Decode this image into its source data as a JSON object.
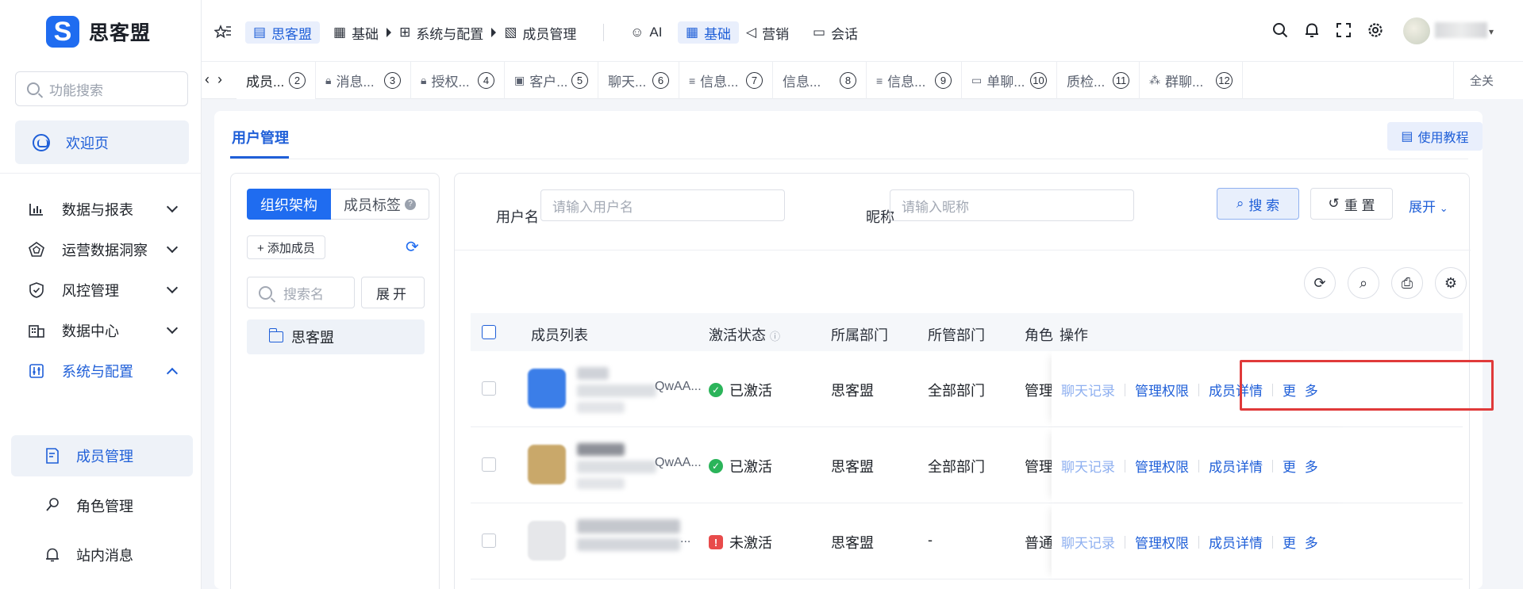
{
  "app": {
    "logo_letter": "S",
    "name": "思客盟"
  },
  "sidebar": {
    "search_placeholder": "功能搜索",
    "welcome": "欢迎页",
    "items": [
      {
        "label": "数据与报表",
        "icon": "bar-chart-icon"
      },
      {
        "label": "运营数据洞察",
        "icon": "radar-icon"
      },
      {
        "label": "风控管理",
        "icon": "shield-check-icon"
      },
      {
        "label": "数据中心",
        "icon": "building-icon"
      },
      {
        "label": "系统与配置",
        "icon": "sliders-icon"
      }
    ],
    "sub_items": [
      {
        "label": "成员管理",
        "icon": "member-doc-icon"
      },
      {
        "label": "角色管理",
        "icon": "key-icon"
      },
      {
        "label": "站内消息",
        "icon": "bell-icon"
      }
    ]
  },
  "topbar": {
    "org_pill": "思客盟",
    "breadcrumb": [
      "基础",
      "系统与配置",
      "成员管理"
    ],
    "modules": [
      "AI",
      "基础",
      "营销",
      "会话"
    ]
  },
  "tabs": {
    "items": [
      {
        "label": "成员...",
        "num": "②"
      },
      {
        "label": "消息...",
        "num": "③"
      },
      {
        "label": "授权...",
        "num": "④"
      },
      {
        "label": "客户...",
        "num": "⑤"
      },
      {
        "label": "聊天...",
        "num": "⑥"
      },
      {
        "label": "信息...",
        "num": "⑦"
      },
      {
        "label": "信息...",
        "num": "⑧"
      },
      {
        "label": "信息...",
        "num": "⑨"
      },
      {
        "label": "单聊...",
        "num": "⑩"
      },
      {
        "label": "质检...",
        "num": "⑪"
      },
      {
        "label": "群聊...",
        "num": "⑫"
      }
    ],
    "close_all": "全关"
  },
  "page": {
    "tab": "用户管理",
    "tutorial": "使用教程"
  },
  "org": {
    "seg_on": "组织架构",
    "seg_off": "成员标签",
    "add_member": "+ 添加成员",
    "search_placeholder": "搜索名",
    "expand": "展开",
    "root_node": "思客盟"
  },
  "filters": {
    "username_label": "用户名",
    "username_placeholder": "请输入用户名",
    "nickname_label": "昵称",
    "nickname_placeholder": "请输入昵称",
    "search": "搜 索",
    "reset": "重 置",
    "expand": "展开"
  },
  "table": {
    "headers": [
      "成员列表",
      "激活状态",
      "所属部门",
      "所管部门",
      "角色",
      "操作"
    ],
    "rows": [
      {
        "member_suffix": "QwAA...",
        "status": "已激活",
        "status_type": "ok",
        "dept": "思客盟",
        "managed": "全部部门",
        "role": "管理员"
      },
      {
        "member_suffix": "QwAA...",
        "status": "已激活",
        "status_type": "ok",
        "dept": "思客盟",
        "managed": "全部部门",
        "role": "管理员"
      },
      {
        "member_suffix": "...",
        "status": "未激活",
        "status_type": "warn",
        "dept": "思客盟",
        "managed": "-",
        "role": "普通成员"
      }
    ],
    "ops": {
      "chat": "聊天记录",
      "perm": "管理权限",
      "detail": "成员详情",
      "more": "更 多"
    }
  },
  "colors": {
    "primary": "#1f6cf0",
    "highlight": "#e03a3a",
    "ok": "#2bb45a",
    "warn": "#e84b4b"
  }
}
